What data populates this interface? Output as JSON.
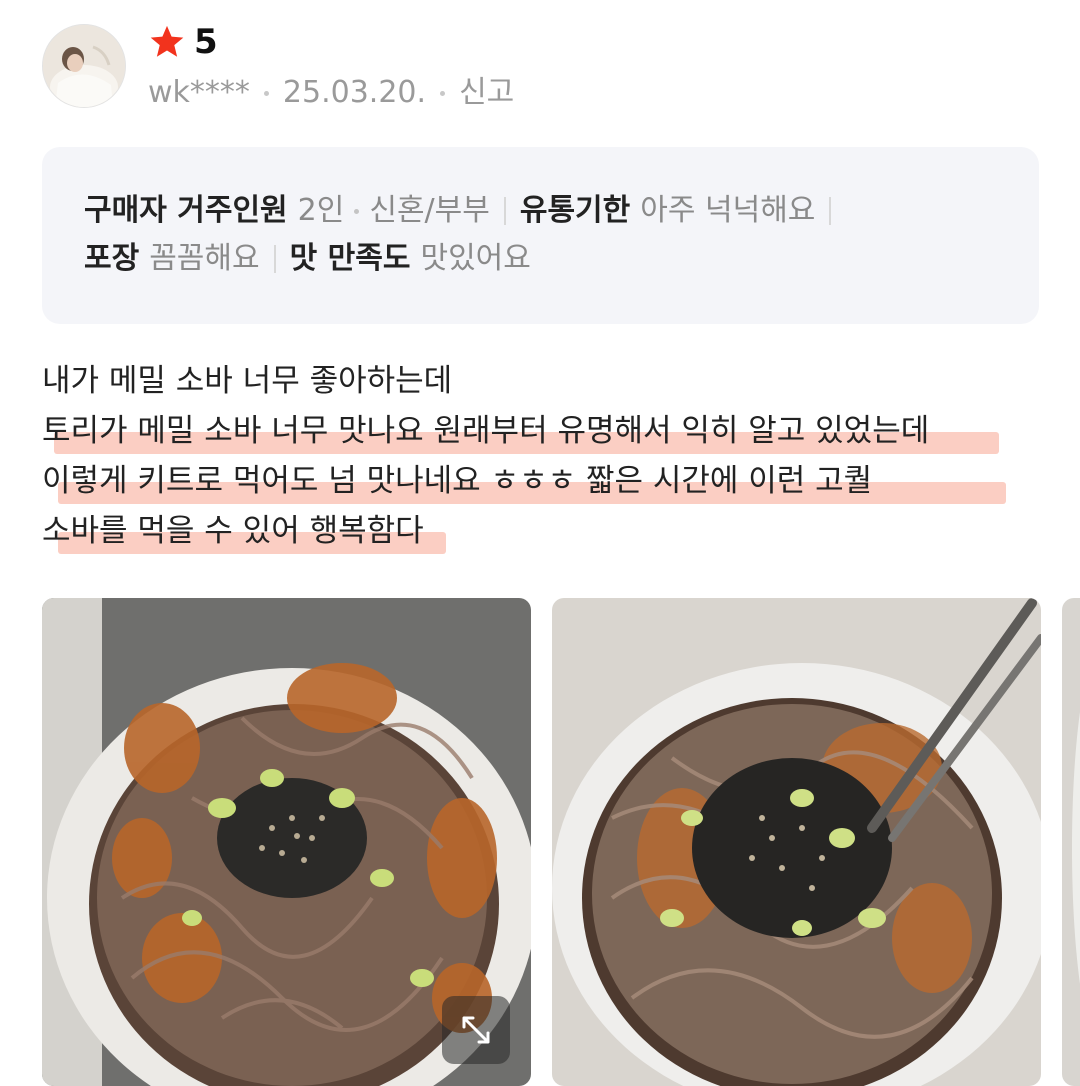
{
  "review": {
    "rating": "5",
    "user": "wk****",
    "date": "25.03.20.",
    "report_label": "신고",
    "survey": {
      "household_key": "구매자 거주인원",
      "household_value": "2인",
      "household_type": "신혼/부부",
      "expiry_key": "유통기한",
      "expiry_value": "아주 넉넉해요",
      "packaging_key": "포장",
      "packaging_value": "꼼꼼해요",
      "taste_key": "맛 만족도",
      "taste_value": "맛있어요"
    },
    "text_lines": [
      "내가 메밀 소바 너무 좋아하는데",
      "토리가 메밀 소바 너무 맛나요 원래부터 유명해서 익히 알고 있었는데",
      "이렇게 키트로 먹어도 넘 맛나네요 ㅎㅎㅎ 짧은 시간에 이런 고퀄",
      "소바를 먹을 수 있어 행복함다"
    ]
  },
  "colors": {
    "star": "#f2331d",
    "highlight": "#f7a692",
    "survey_bg": "#f4f5f9"
  },
  "icons": {
    "rating": "star-icon",
    "expand": "expand-icon"
  }
}
